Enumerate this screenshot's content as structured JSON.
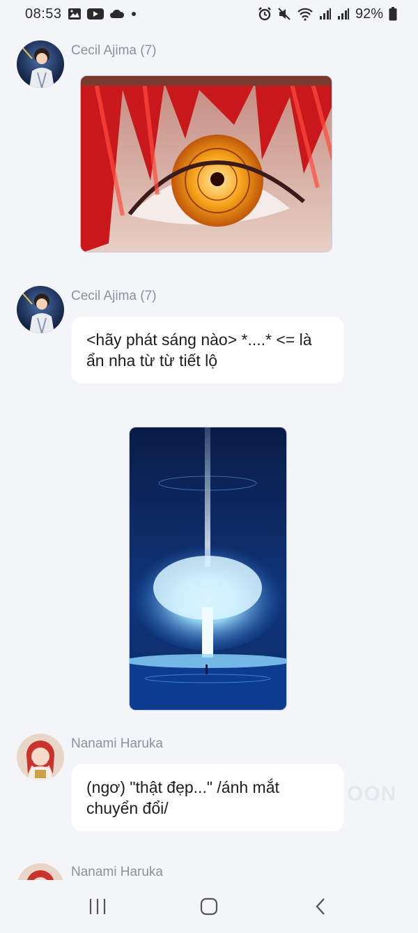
{
  "status_bar": {
    "time": "08:53",
    "battery": "92%",
    "left_icons": [
      "gallery-icon",
      "youtube-icon",
      "cloud-icon",
      "dot-icon"
    ],
    "right_icons": [
      "alarm-icon",
      "mute-icon",
      "wifi-icon",
      "signal-icon",
      "signal-icon",
      "battery-icon"
    ]
  },
  "messages": [
    {
      "sender": "Cecil Ajima (7)",
      "type": "image",
      "image": "red-haired-anime-eye"
    },
    {
      "sender": "Cecil Ajima (7)",
      "type": "text",
      "text": "<hãy phát sáng nào> *....* <= là ẩn nha từ từ tiết lộ"
    },
    {
      "sender": "",
      "type": "image",
      "image": "glowing-tree-night"
    },
    {
      "sender": "Nanami Haruka",
      "type": "text",
      "text": "(ngơ) \"thật đẹp...\" /ánh mắt chuyển đổi/"
    },
    {
      "sender": "Nanami Haruka",
      "type": "partial"
    }
  ],
  "watermark": "OON",
  "nav_bar": {
    "buttons": [
      "recent-apps-icon",
      "home-icon",
      "back-icon"
    ]
  },
  "colors": {
    "background": "#f4f5f9",
    "bubble": "#ffffff",
    "sender": "#8e9098"
  }
}
